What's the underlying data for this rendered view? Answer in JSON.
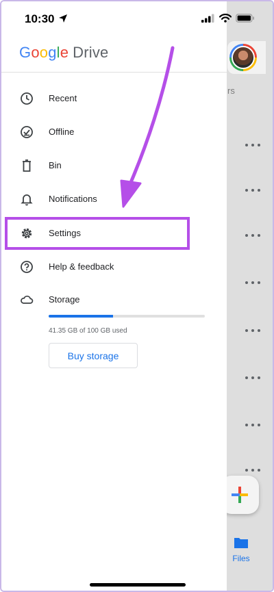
{
  "status_bar": {
    "time": "10:30"
  },
  "header": {
    "logo_google": [
      "G",
      "o",
      "o",
      "g",
      "l",
      "e"
    ],
    "logo_drive": "Drive"
  },
  "background": {
    "tab_text_fragment": "rs",
    "files_label": "Files"
  },
  "menu": {
    "items": [
      {
        "label": "Recent",
        "icon": "clock-icon"
      },
      {
        "label": "Offline",
        "icon": "offline-icon"
      },
      {
        "label": "Bin",
        "icon": "trash-icon"
      },
      {
        "label": "Notifications",
        "icon": "bell-icon"
      },
      {
        "label": "Settings",
        "icon": "gear-icon"
      },
      {
        "label": "Help & feedback",
        "icon": "help-icon"
      },
      {
        "label": "Storage",
        "icon": "cloud-icon"
      }
    ]
  },
  "storage": {
    "used_text": "41.35 GB of 100 GB used",
    "used_fraction": 0.4135,
    "buy_label": "Buy storage"
  },
  "colors": {
    "highlight": "#b54fe8",
    "accent_blue": "#1a73e8"
  }
}
